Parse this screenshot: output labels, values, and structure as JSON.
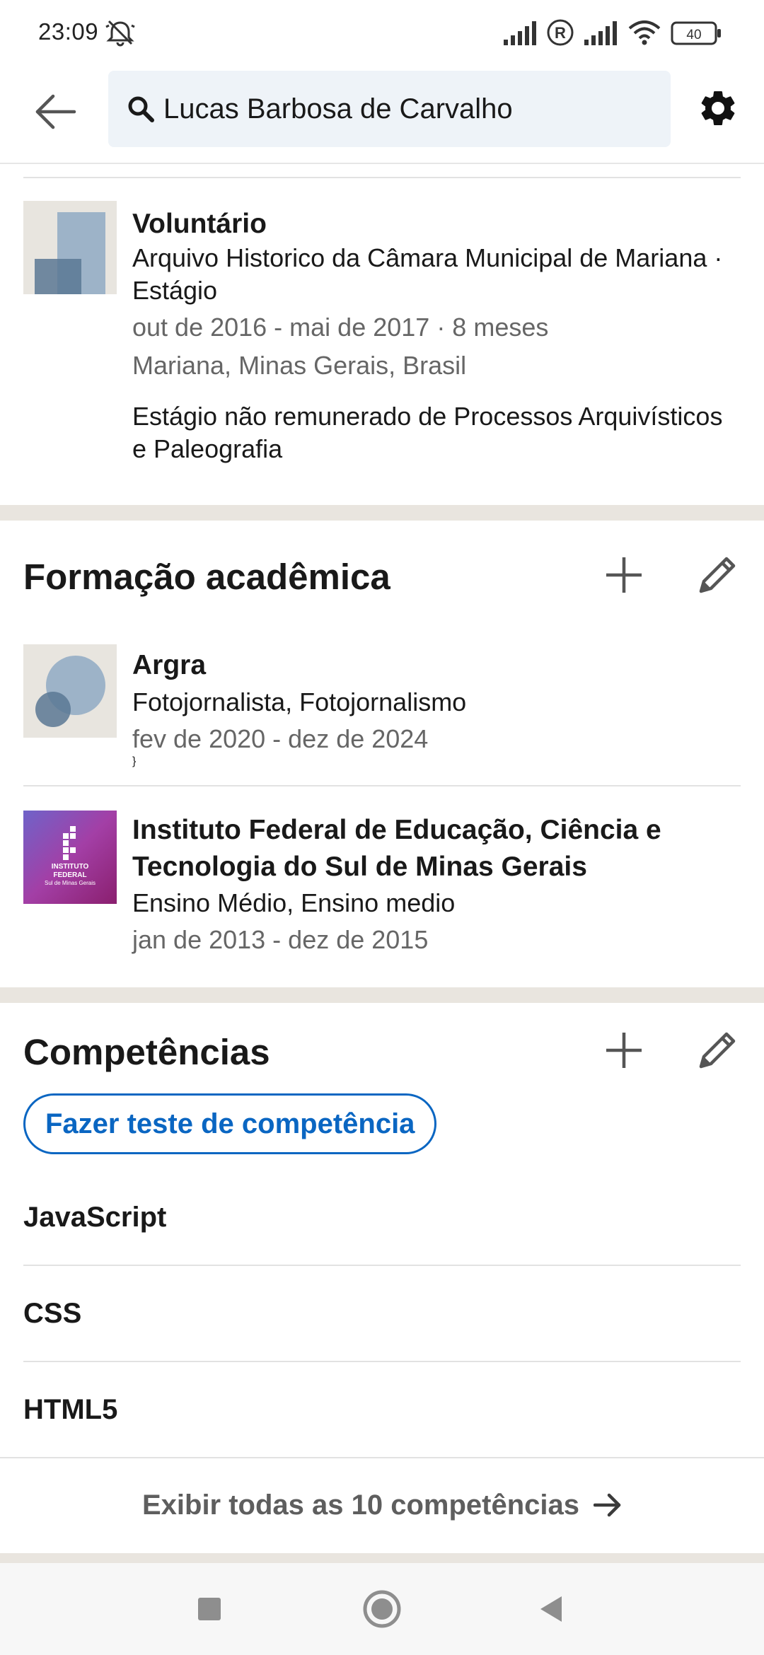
{
  "status_bar": {
    "time": "23:09",
    "battery": "40",
    "icons": [
      "dnd-off-icon",
      "signal-icon",
      "roaming-icon",
      "signal-icon",
      "wifi-icon",
      "battery-icon"
    ]
  },
  "app_bar": {
    "back_icon": "arrow-left-icon",
    "search_value": "Lucas Barbosa de Carvalho",
    "settings_icon": "gear-icon"
  },
  "experience_entry": {
    "title": "Voluntário",
    "org_line": "Arquivo Historico da Câmara Municipal de Mariana · Estágio",
    "dates": "out de 2016 - mai de 2017 · 8 meses",
    "location": "Mariana, Minas Gerais, Brasil",
    "description": "Estágio não remunerado de Processos Arquivísticos e Paleografia"
  },
  "education": {
    "title": "Formação acadêmica",
    "items": [
      {
        "school": "Argra",
        "degree": "Fotojornalista, Fotojornalismo",
        "dates": "fev de 2020 - dez de 2024"
      },
      {
        "school": "Instituto Federal de Educação, Ciência e Tecnologia do Sul de Minas Gerais",
        "degree": "Ensino Médio, Ensino medio",
        "dates": "jan de 2013 - dez de 2015",
        "logo_text_1": "INSTITUTO",
        "logo_text_2": "FEDERAL",
        "logo_text_3": "Sul de Minas Gerais"
      }
    ]
  },
  "skills": {
    "title": "Competências",
    "test_button": "Fazer teste de competência",
    "items": [
      "JavaScript",
      "CSS",
      "HTML5"
    ],
    "show_all": "Exibir todas as 10 competências"
  },
  "colors": {
    "accent": "#0a66c2",
    "divider": "#e9e5df",
    "muted_text": "#666666"
  }
}
